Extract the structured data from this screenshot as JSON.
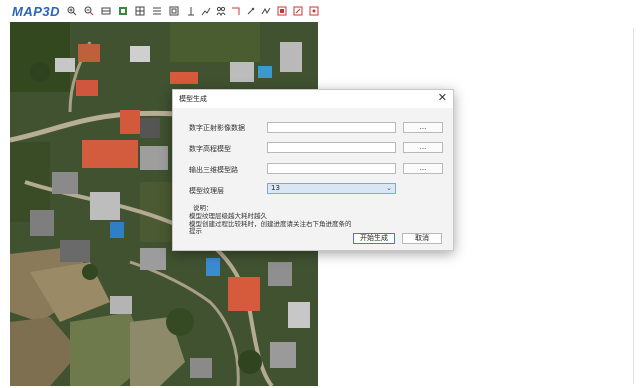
{
  "app": {
    "logo": "MAP3D"
  },
  "toolbar": {
    "icons": [
      "zoom-in-icon",
      "zoom-out-icon",
      "pan-icon",
      "layers-icon",
      "grid-icon",
      "table-icon",
      "crop-icon",
      "measure-icon",
      "chart-icon",
      "people-icon",
      "route-icon",
      "edit-icon",
      "polyline-icon",
      "select-icon",
      "export-icon",
      "settings-icon"
    ]
  },
  "dialog": {
    "title": "模型生成",
    "close": "✕",
    "fields": [
      {
        "label": "数字正射影像数据",
        "value": "",
        "browse": "..."
      },
      {
        "label": "数字高程模型",
        "value": "",
        "browse": "..."
      },
      {
        "label": "输出三维模型路",
        "value": "",
        "browse": "..."
      }
    ],
    "level_label": "模型纹理层",
    "level_value": "13",
    "notes": [
      "说明：",
      "模型纹理层级越大耗时越久",
      "模型创建过程比较耗时，创建进度请关注右下角进度条的",
      "提示"
    ],
    "generate_button": "开始生成",
    "cancel_button": "取消"
  },
  "colors": {
    "logo": "#2a63b8",
    "select_bg": "#d9e6f4",
    "toolbar_red": "#d03a3a",
    "toolbar_green": "#3a8a3a"
  }
}
